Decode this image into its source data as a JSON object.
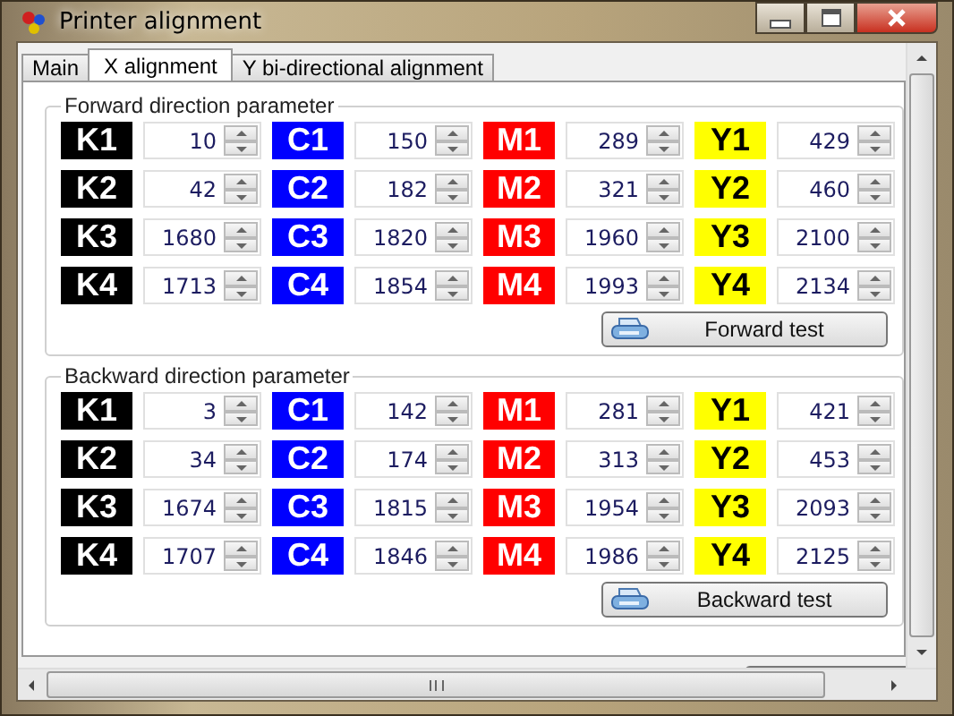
{
  "window": {
    "title": "Printer alignment"
  },
  "tabs": [
    {
      "label": "Main",
      "selected": false
    },
    {
      "label": "X alignment",
      "selected": true
    },
    {
      "label": "Y bi-directional alignment",
      "selected": false
    }
  ],
  "groups": [
    {
      "title": "Forward direction parameter",
      "button": "Forward test",
      "rows": [
        [
          {
            "label": "K1",
            "color": "#000000",
            "value": "10"
          },
          {
            "label": "C1",
            "color": "#0000ff",
            "value": "150"
          },
          {
            "label": "M1",
            "color": "#ff0000",
            "value": "289"
          },
          {
            "label": "Y1",
            "color": "#ffff00",
            "value": "429"
          }
        ],
        [
          {
            "label": "K2",
            "color": "#000000",
            "value": "42"
          },
          {
            "label": "C2",
            "color": "#0000ff",
            "value": "182"
          },
          {
            "label": "M2",
            "color": "#ff0000",
            "value": "321"
          },
          {
            "label": "Y2",
            "color": "#ffff00",
            "value": "460"
          }
        ],
        [
          {
            "label": "K3",
            "color": "#000000",
            "value": "1680"
          },
          {
            "label": "C3",
            "color": "#0000ff",
            "value": "1820"
          },
          {
            "label": "M3",
            "color": "#ff0000",
            "value": "1960"
          },
          {
            "label": "Y3",
            "color": "#ffff00",
            "value": "2100"
          }
        ],
        [
          {
            "label": "K4",
            "color": "#000000",
            "value": "1713"
          },
          {
            "label": "C4",
            "color": "#0000ff",
            "value": "1854"
          },
          {
            "label": "M4",
            "color": "#ff0000",
            "value": "1993"
          },
          {
            "label": "Y4",
            "color": "#ffff00",
            "value": "2134"
          }
        ]
      ]
    },
    {
      "title": "Backward direction parameter",
      "button": "Backward test",
      "rows": [
        [
          {
            "label": "K1",
            "color": "#000000",
            "value": "3"
          },
          {
            "label": "C1",
            "color": "#0000ff",
            "value": "142"
          },
          {
            "label": "M1",
            "color": "#ff0000",
            "value": "281"
          },
          {
            "label": "Y1",
            "color": "#ffff00",
            "value": "421"
          }
        ],
        [
          {
            "label": "K2",
            "color": "#000000",
            "value": "34"
          },
          {
            "label": "C2",
            "color": "#0000ff",
            "value": "174"
          },
          {
            "label": "M2",
            "color": "#ff0000",
            "value": "313"
          },
          {
            "label": "Y2",
            "color": "#ffff00",
            "value": "453"
          }
        ],
        [
          {
            "label": "K3",
            "color": "#000000",
            "value": "1674"
          },
          {
            "label": "C3",
            "color": "#0000ff",
            "value": "1815"
          },
          {
            "label": "M3",
            "color": "#ff0000",
            "value": "1954"
          },
          {
            "label": "Y3",
            "color": "#ffff00",
            "value": "2093"
          }
        ],
        [
          {
            "label": "K4",
            "color": "#000000",
            "value": "1707"
          },
          {
            "label": "C4",
            "color": "#0000ff",
            "value": "1846"
          },
          {
            "label": "M4",
            "color": "#ff0000",
            "value": "1986"
          },
          {
            "label": "Y4",
            "color": "#ffff00",
            "value": "2125"
          }
        ]
      ]
    }
  ]
}
